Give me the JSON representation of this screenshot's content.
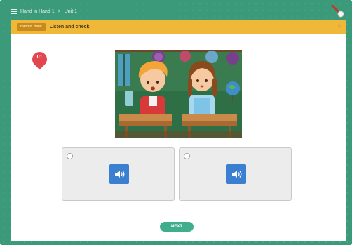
{
  "breadcrumb": {
    "book": "Hand in Hand 1",
    "separator": ">",
    "unit": "Unit 1"
  },
  "instruction": {
    "tag": "Hand in Hand",
    "text": "Listen and check.",
    "close": "×"
  },
  "question": {
    "number": "01"
  },
  "options": [
    {
      "selected": false,
      "icon": "speaker-icon"
    },
    {
      "selected": false,
      "icon": "speaker-icon"
    }
  ],
  "next_button": {
    "label": "NEXT"
  },
  "colors": {
    "frame": "#3a9a7a",
    "instruction_bar": "#f0b838",
    "badge": "#e2474f",
    "audio_button": "#3b7fd0",
    "next_button": "#3fae8c"
  }
}
